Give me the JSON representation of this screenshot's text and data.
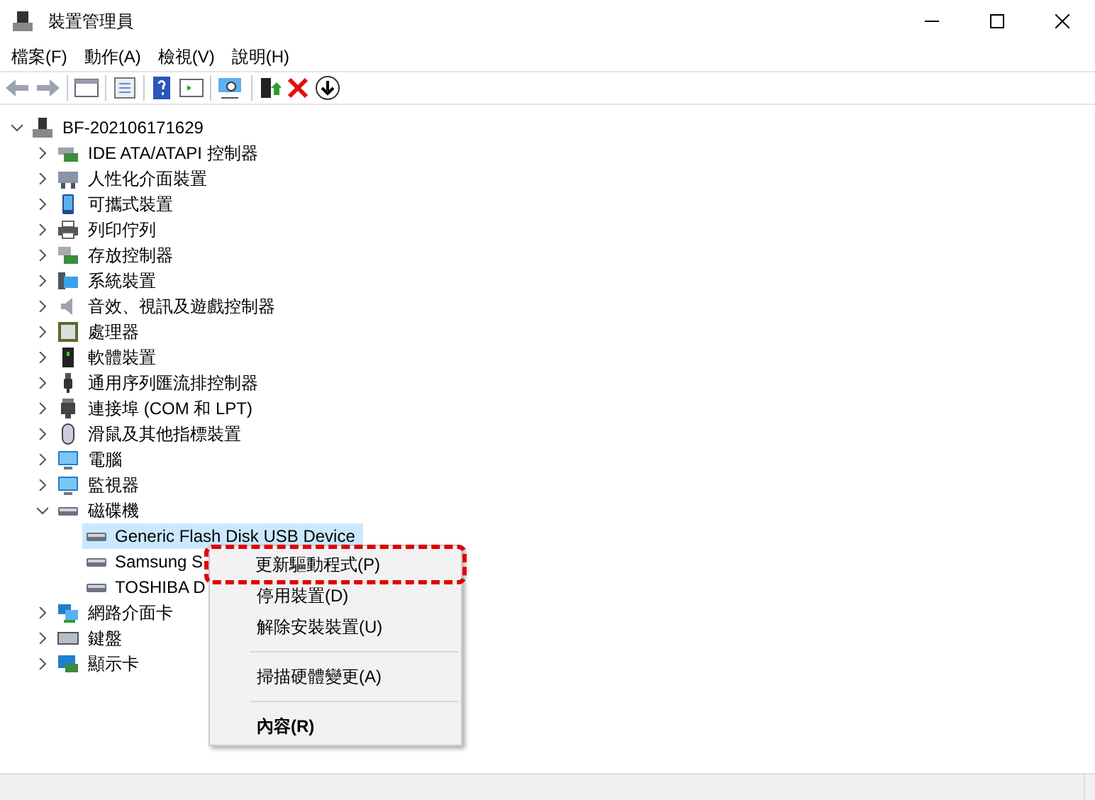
{
  "window": {
    "title": "裝置管理員"
  },
  "menu_bar": [
    "檔案(F)",
    "動作(A)",
    "檢視(V)",
    "說明(H)"
  ],
  "tree": {
    "label": "BF-202106171629",
    "expanded": true,
    "children": [
      {
        "label": "IDE ATA/ATAPI 控制器",
        "expanded": false
      },
      {
        "label": "人性化介面裝置",
        "expanded": false
      },
      {
        "label": "可攜式裝置",
        "expanded": false
      },
      {
        "label": "列印佇列",
        "expanded": false
      },
      {
        "label": "存放控制器",
        "expanded": false
      },
      {
        "label": "系統裝置",
        "expanded": false
      },
      {
        "label": "音效、視訊及遊戲控制器",
        "expanded": false
      },
      {
        "label": "處理器",
        "expanded": false
      },
      {
        "label": "軟體裝置",
        "expanded": false
      },
      {
        "label": "通用序列匯流排控制器",
        "expanded": false
      },
      {
        "label": "連接埠 (COM 和 LPT)",
        "expanded": false
      },
      {
        "label": "滑鼠及其他指標裝置",
        "expanded": false
      },
      {
        "label": "電腦",
        "expanded": false
      },
      {
        "label": "監視器",
        "expanded": false
      },
      {
        "label": "磁碟機",
        "expanded": true,
        "children": [
          {
            "label": "Generic Flash Disk USB Device",
            "selected": true
          },
          {
            "label": "Samsung S",
            "selected": false
          },
          {
            "label": "TOSHIBA D",
            "selected": false
          }
        ]
      },
      {
        "label": "網路介面卡",
        "expanded": false
      },
      {
        "label": "鍵盤",
        "expanded": false
      },
      {
        "label": "顯示卡",
        "expanded": false
      }
    ]
  },
  "context_menu": [
    {
      "kind": "item",
      "label": "更新驅動程式(P)",
      "highlighted": true,
      "default": false
    },
    {
      "kind": "item",
      "label": "停用裝置(D)",
      "highlighted": false,
      "default": false
    },
    {
      "kind": "item",
      "label": "解除安裝裝置(U)",
      "highlighted": false,
      "default": false
    },
    {
      "kind": "separator"
    },
    {
      "kind": "item",
      "label": "掃描硬體變更(A)",
      "highlighted": false,
      "default": false
    },
    {
      "kind": "separator"
    },
    {
      "kind": "item",
      "label": "內容(R)",
      "highlighted": false,
      "default": true
    }
  ]
}
